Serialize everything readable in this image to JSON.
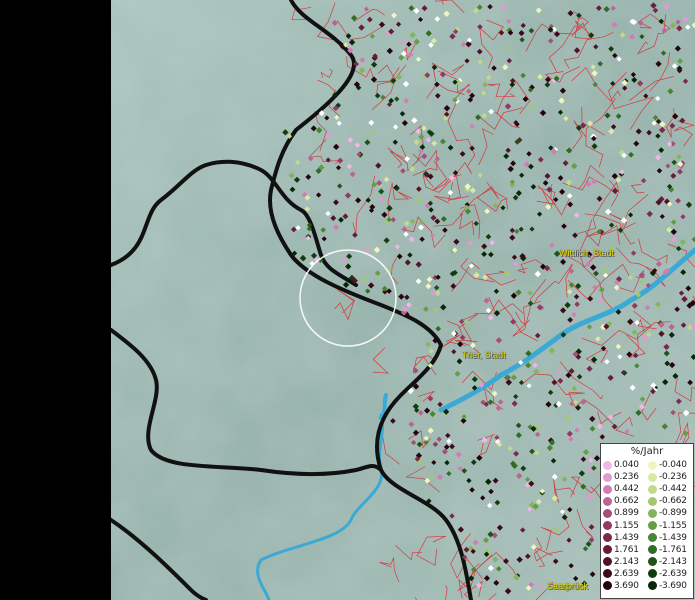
{
  "map": {
    "labels": [
      {
        "id": "wittlich",
        "text": "Wittlich, Stadt"
      },
      {
        "id": "trier",
        "text": "Trier, Stadt"
      },
      {
        "id": "saarbruecken",
        "text": "Saarbrück"
      }
    ]
  },
  "legend": {
    "title": "%/Jahr",
    "positive": [
      {
        "value": "0.040",
        "color": "#f2b6e6"
      },
      {
        "value": "0.236",
        "color": "#e39ad2"
      },
      {
        "value": "0.442",
        "color": "#d07db4"
      },
      {
        "value": "0.662",
        "color": "#bb6596"
      },
      {
        "value": "0.899",
        "color": "#a64e7a"
      },
      {
        "value": "1.155",
        "color": "#923a62"
      },
      {
        "value": "1.439",
        "color": "#7c2a4c"
      },
      {
        "value": "1.761",
        "color": "#671c38"
      },
      {
        "value": "2.143",
        "color": "#521227"
      },
      {
        "value": "2.639",
        "color": "#3c0a19"
      },
      {
        "value": "3.690",
        "color": "#26040d"
      }
    ],
    "negative": [
      {
        "value": "-0.040",
        "color": "#f0f5c0"
      },
      {
        "value": "-0.236",
        "color": "#d8eaa0"
      },
      {
        "value": "-0.442",
        "color": "#bedb86"
      },
      {
        "value": "-0.662",
        "color": "#a2c96e"
      },
      {
        "value": "-0.899",
        "color": "#84b55a"
      },
      {
        "value": "-1.155",
        "color": "#649e46"
      },
      {
        "value": "-1.439",
        "color": "#488634"
      },
      {
        "value": "-1.761",
        "color": "#306c24"
      },
      {
        "value": "-2.143",
        "color": "#1e5418"
      },
      {
        "value": "-2.639",
        "color": "#103c0e"
      },
      {
        "value": "-3.690",
        "color": "#062806"
      }
    ]
  },
  "colors": {
    "terrain": "#9fbab3",
    "border": "#111111",
    "admin_lines": "#d9252a",
    "river": "#3aa9d6",
    "label_text": "#e8e000"
  }
}
